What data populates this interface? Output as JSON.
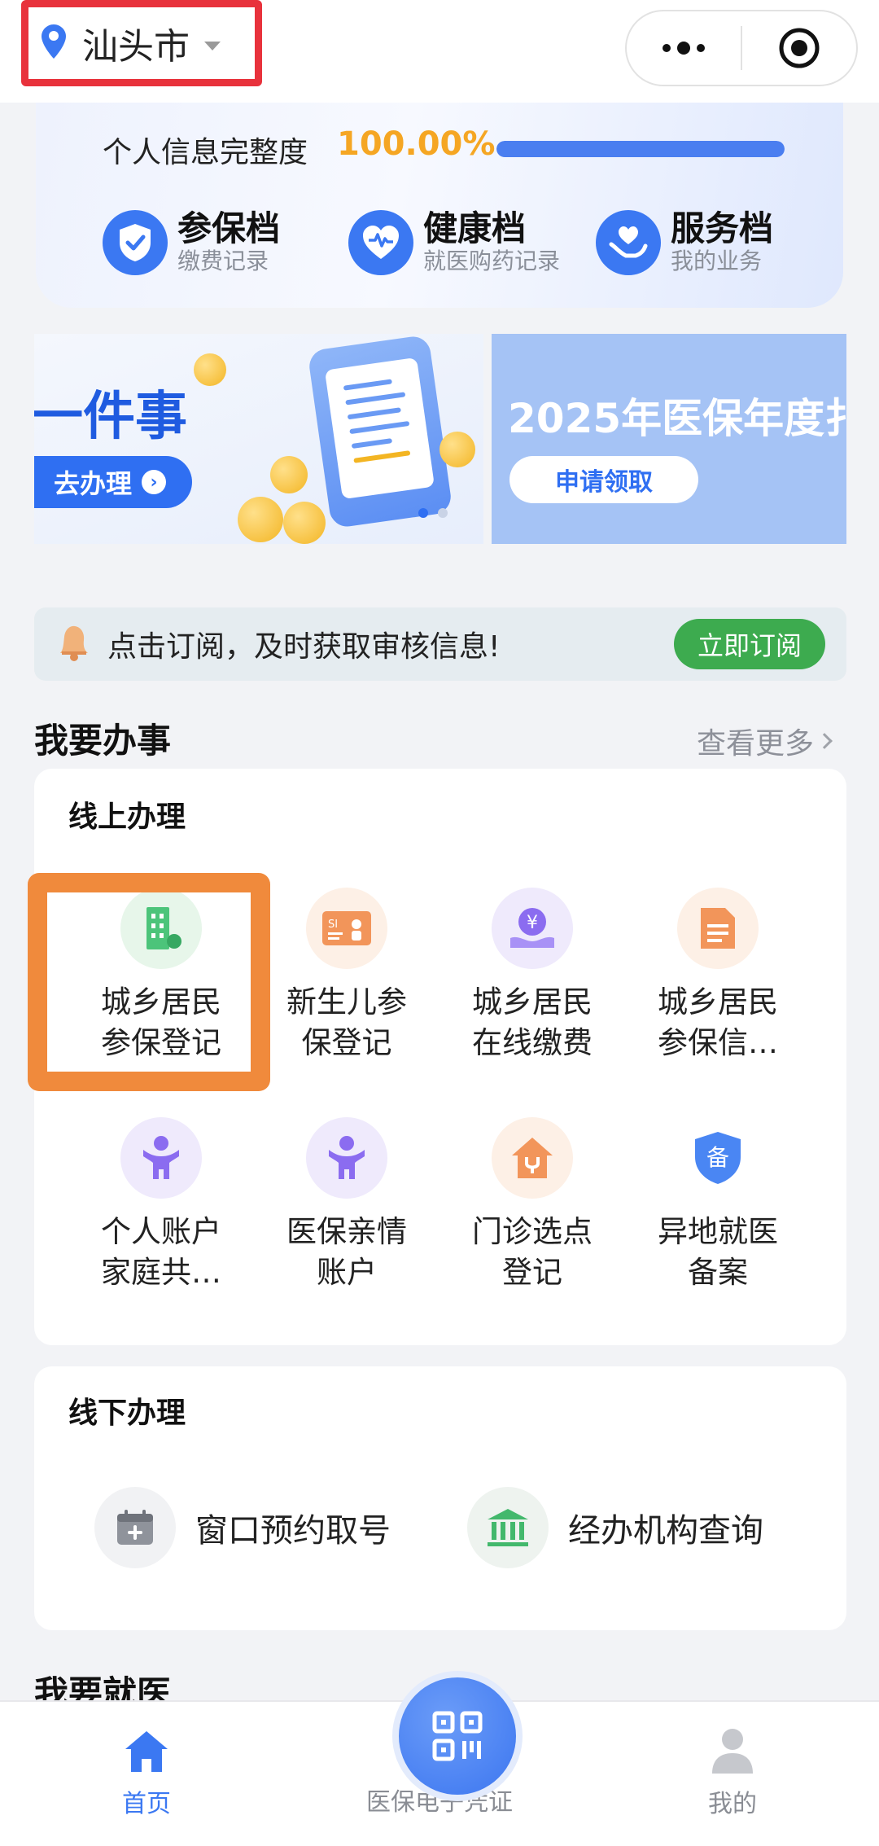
{
  "topbar": {
    "city": "汕头市"
  },
  "profile": {
    "label": "个人信息完整度",
    "percent_text": "100.00%",
    "percent_value": 1.0,
    "archives": [
      {
        "title": "参保档",
        "sub": "缴费记录",
        "icon": "shield-check-icon"
      },
      {
        "title": "健康档",
        "sub": "就医购药记录",
        "icon": "heartbeat-icon"
      },
      {
        "title": "服务档",
        "sub": "我的业务",
        "icon": "heart-hands-icon"
      }
    ]
  },
  "banners": [
    {
      "title": "一件事",
      "button": "去办理"
    },
    {
      "title": "2025年医保年度扌",
      "button": "申请领取"
    }
  ],
  "subscribe": {
    "text": "点击订阅，及时获取审核信息!",
    "button": "立即订阅"
  },
  "tasks": {
    "title": "我要办事",
    "more": "查看更多",
    "online": {
      "title": "线上办理",
      "items": [
        {
          "l1": "城乡居民",
          "l2": "参保登记",
          "icon": "building-icon",
          "bg": "#e7f6ea"
        },
        {
          "l1": "新生儿参",
          "l2": "保登记",
          "icon": "si-card-icon",
          "bg": "#fdf0e6"
        },
        {
          "l1": "城乡居民",
          "l2": "在线缴费",
          "icon": "yuan-hand-icon",
          "bg": "#efeafc"
        },
        {
          "l1": "城乡居民",
          "l2": "参保信…",
          "icon": "document-icon",
          "bg": "#fdf0e6"
        },
        {
          "l1": "个人账户",
          "l2": "家庭共…",
          "icon": "person-icon",
          "bg": "#efeafc"
        },
        {
          "l1": "医保亲情",
          "l2": "账户",
          "icon": "person-icon",
          "bg": "#efeafc"
        },
        {
          "l1": "门诊选点",
          "l2": "登记",
          "icon": "clinic-icon",
          "bg": "#fdf0e6"
        },
        {
          "l1": "异地就医",
          "l2": "备案",
          "icon": "bei-shield-icon",
          "bg": "#ffffff"
        }
      ]
    },
    "offline": {
      "title": "线下办理",
      "items": [
        {
          "label": "窗口预约取号",
          "icon": "calendar-plus-icon"
        },
        {
          "label": "经办机构查询",
          "icon": "institution-icon"
        }
      ]
    }
  },
  "medical": {
    "title": "我要就医"
  },
  "tabbar": [
    {
      "label": "首页",
      "icon": "home-icon",
      "active": true
    },
    {
      "label": "医保电子凭证",
      "icon": "qr-code-icon",
      "active": false
    },
    {
      "label": "我的",
      "icon": "user-icon",
      "active": false
    }
  ],
  "colors": {
    "accent": "#3b78f2",
    "percent": "#f5a623",
    "subscribe_button": "#3dab4f",
    "highlight_orange": "#f08a3c",
    "highlight_red": "#e8323c"
  }
}
